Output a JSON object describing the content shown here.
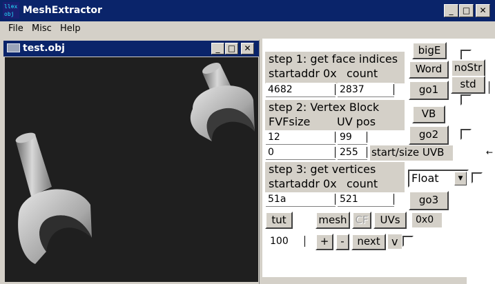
{
  "app": {
    "title": "MeshExtractor",
    "icon_text_1": "ll⊕x",
    "icon_text_2": "obj"
  },
  "window_controls": {
    "minimize": "_",
    "maximize": "□",
    "close": "✕"
  },
  "menu": {
    "file": "File",
    "misc": "Misc",
    "help": "Help"
  },
  "child_window": {
    "title": "test.obj"
  },
  "step1": {
    "heading": "step 1: get face indices",
    "col1": "startaddr 0x",
    "col2": "count",
    "startaddr": "4682",
    "count": "2837"
  },
  "step2": {
    "heading": "step 2: Vertex Block",
    "col1": "FVFsize",
    "col2": "UV pos",
    "fvfsize": "12",
    "uvpos": "99",
    "start": "0",
    "size": "255",
    "uvb_label": "start/size UVB"
  },
  "step3": {
    "heading": "step 3: get vertices",
    "col1": "startaddr 0x",
    "col2": "count",
    "startaddr": "51a",
    "count": "521"
  },
  "buttons": {
    "bigE": "bigE",
    "word": "Word",
    "nostr": "noStr",
    "std": "std",
    "go1": "go1",
    "vb": "VB",
    "go2": "go2",
    "go3": "go3",
    "tut": "tut",
    "mesh": "mesh",
    "cf": "CF",
    "uvs": "UVs",
    "plus": "+",
    "minus": "-",
    "next": "next",
    "v": "v"
  },
  "combo": {
    "selected": "Float"
  },
  "hex_display": "0x0",
  "step_field": "100",
  "colors": {
    "titlebar": "#0a246a",
    "face": "#d4d0c8",
    "viewport": "#1f1f1f"
  }
}
